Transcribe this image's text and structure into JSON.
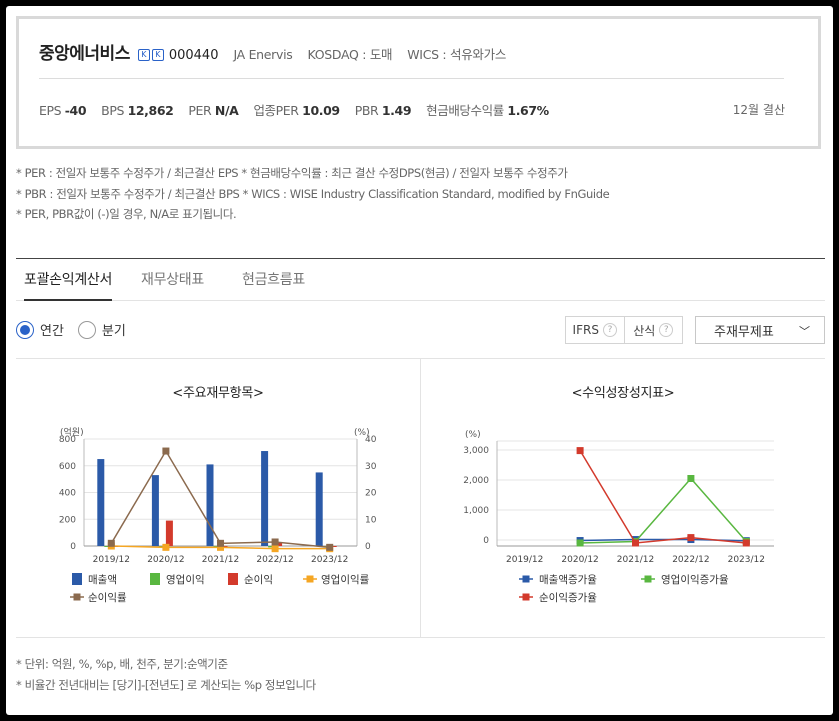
{
  "header": {
    "company": "중앙에너비스",
    "badges": [
      "K",
      "K"
    ],
    "code": "000440",
    "english_name": "JA Enervis",
    "market": "KOSDAQ : 도매",
    "wics": "WICS : 석유와가스",
    "stats": [
      {
        "label": "EPS",
        "value": "-40"
      },
      {
        "label": "BPS",
        "value": "12,862"
      },
      {
        "label": "PER",
        "value": "N/A"
      },
      {
        "label": "업종PER",
        "value": "10.09"
      },
      {
        "label": "PBR",
        "value": "1.49"
      },
      {
        "label": "현금배당수익률",
        "value": "1.67%"
      }
    ],
    "fiscal": "12월 결산"
  },
  "notes": [
    "* PER : 전일자 보통주 수정주가 / 최근결산 EPS * 현금배당수익률 : 최근 결산 수정DPS(현금) / 전일자 보통주 수정주가",
    "* PBR : 전일자 보통주 수정주가 / 최근결산 BPS * WICS : WISE Industry Classification Standard, modified by FnGuide",
    "* PER, PBR값이 (-)일 경우, N/A로 표기됩니다."
  ],
  "tabs": [
    "포괄손익계산서",
    "재무상태표",
    "현금흐름표"
  ],
  "period_options": [
    "연간",
    "분기"
  ],
  "options": {
    "ifrs": "IFRS",
    "calc": "산식",
    "qmark": "?",
    "select_value": "주재무제표",
    "chevron": "﹀"
  },
  "colors": {
    "revenue": "#2b5aa8",
    "op_income": "#59b740",
    "net_income": "#d33a2c",
    "op_margin": "#f5a623",
    "net_margin": "#8b6a4e",
    "rev_growth": "#2b5aa8",
    "op_growth": "#59b740",
    "net_growth": "#d33a2c"
  },
  "chart_data": [
    {
      "type": "bar",
      "title": "<주요재무항목>",
      "y_unit_left": "(억원)",
      "y_unit_right": "(%)",
      "categories": [
        "2019/12",
        "2020/12",
        "2021/12",
        "2022/12",
        "2023/12"
      ],
      "ylim_left": [
        0,
        800
      ],
      "left_ticks": [
        "800",
        "600",
        "400",
        "200",
        "0"
      ],
      "ylim_right": [
        0,
        40
      ],
      "right_ticks": [
        "40",
        "30",
        "20",
        "10",
        "0"
      ],
      "series": [
        {
          "name": "매출액",
          "kind": "bar",
          "axis": "left",
          "values": [
            650,
            530,
            610,
            710,
            550
          ]
        },
        {
          "name": "영업이익",
          "kind": "bar",
          "axis": "left",
          "values": [
            -5,
            -10,
            -5,
            -10,
            -8
          ]
        },
        {
          "name": "순이익",
          "kind": "bar",
          "axis": "left",
          "values": [
            -3,
            190,
            -5,
            30,
            -4
          ]
        },
        {
          "name": "영업이익률",
          "kind": "line",
          "axis": "right",
          "values": [
            0,
            -0.5,
            -0.5,
            -1,
            -1
          ]
        },
        {
          "name": "순이익률",
          "kind": "line",
          "axis": "right",
          "values": [
            1,
            35.5,
            1,
            1.5,
            -0.5
          ]
        }
      ]
    },
    {
      "type": "line",
      "title": "<수익성장성지표>",
      "y_unit_left": "(%)",
      "categories": [
        "2019/12",
        "2020/12",
        "2021/12",
        "2022/12",
        "2023/12"
      ],
      "ylim": [
        -200,
        3300
      ],
      "ticks": [
        "3,000",
        "2,000",
        "1,000",
        "0"
      ],
      "series": [
        {
          "name": "매출액증가율",
          "values": [
            null,
            -18,
            15,
            16,
            -23
          ]
        },
        {
          "name": "영업이익증가율",
          "values": [
            null,
            -100,
            -50,
            2050,
            -50
          ]
        },
        {
          "name": "순이익증가율",
          "values": [
            null,
            2980,
            -100,
            80,
            -100
          ]
        }
      ]
    }
  ],
  "footnotes": [
    "* 단위: 억원, %, %p, 배, 천주, 분기:순액기준",
    "* 비율간 전년대비는 [당기]-[전년도] 로 계산되는 %p 정보입니다"
  ]
}
